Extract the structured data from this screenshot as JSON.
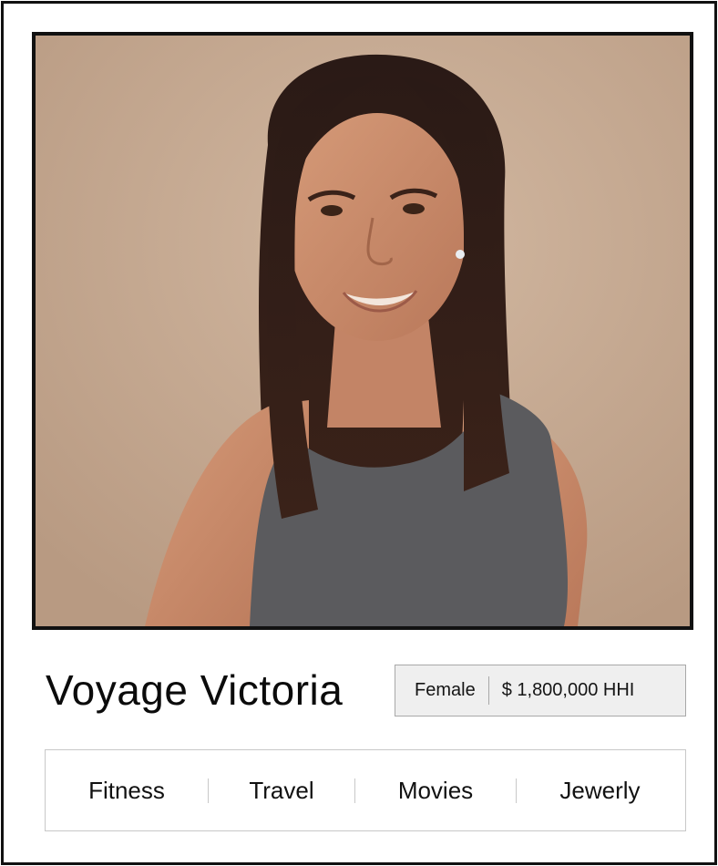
{
  "persona": {
    "name": "Voyage Victoria",
    "gender": "Female",
    "income": "$ 1,800,000 HHI"
  },
  "interests": [
    {
      "label": "Fitness"
    },
    {
      "label": "Travel"
    },
    {
      "label": "Movies"
    },
    {
      "label": "Jewerly"
    }
  ],
  "colors": {
    "frame": "#111111",
    "photo_background": "#c9ad95",
    "badge_background": "#efefef",
    "border_gray": "#c8c8c8"
  }
}
